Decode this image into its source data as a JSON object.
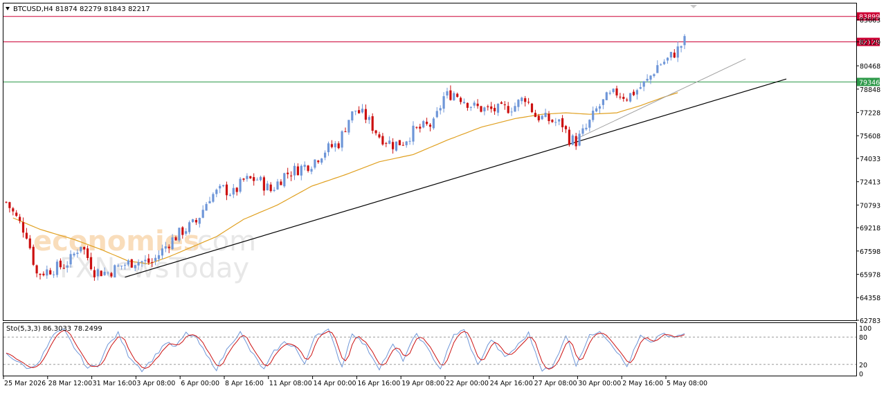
{
  "chart_data": [
    {
      "type": "candlestick",
      "symbol_header": "BTCUSD,H4  81874 82279 81843 82217",
      "y_ticks": [
        83663,
        82129,
        80468,
        78848,
        77228,
        75608,
        74033,
        72413,
        70793,
        69218,
        67598,
        65978,
        64358,
        62783
      ],
      "ylim": [
        62783,
        84800
      ],
      "x_ticks": [
        "25 Mar 2026",
        "28 Mar 12:00",
        "31 Mar 16:00",
        "3 Apr 08:00",
        "6 Apr 00:00",
        "8 Apr 16:00",
        "11 Apr 08:00",
        "14 Apr 00:00",
        "16 Apr 16:00",
        "19 Apr 08:00",
        "22 Apr 00:00",
        "24 Apr 16:00",
        "27 Apr 08:00",
        "30 Apr 00:00",
        "2 May 16:00",
        "5 May 08:00"
      ],
      "bull_color": "#6e96d8",
      "bear_color": "#cc1010",
      "ma_color": "#e0a020",
      "price_anchors": [
        [
          0,
          71000
        ],
        [
          6,
          68800
        ],
        [
          9,
          66000
        ],
        [
          13,
          66300
        ],
        [
          17,
          66600
        ],
        [
          19,
          67000
        ],
        [
          22,
          68100
        ],
        [
          26,
          66200
        ],
        [
          30,
          66100
        ],
        [
          34,
          66600
        ],
        [
          38,
          66900
        ],
        [
          43,
          66800
        ],
        [
          48,
          68200
        ],
        [
          52,
          69000
        ],
        [
          56,
          69600
        ],
        [
          60,
          71400
        ],
        [
          64,
          71900
        ],
        [
          67,
          71600
        ],
        [
          70,
          72500
        ],
        [
          74,
          72600
        ],
        [
          78,
          71800
        ],
        [
          82,
          72900
        ],
        [
          86,
          73300
        ],
        [
          90,
          73700
        ],
        [
          94,
          74600
        ],
        [
          98,
          75100
        ],
        [
          101,
          76800
        ],
        [
          103,
          77400
        ],
        [
          106,
          76900
        ],
        [
          110,
          75600
        ],
        [
          114,
          75000
        ],
        [
          117,
          75200
        ],
        [
          120,
          75900
        ],
        [
          123,
          76200
        ],
        [
          126,
          76400
        ],
        [
          129,
          78300
        ],
        [
          132,
          78600
        ],
        [
          135,
          78100
        ],
        [
          138,
          77600
        ],
        [
          142,
          77400
        ],
        [
          146,
          77400
        ],
        [
          150,
          77700
        ],
        [
          153,
          78300
        ],
        [
          156,
          77000
        ],
        [
          160,
          76700
        ],
        [
          164,
          76400
        ],
        [
          166,
          75400
        ],
        [
          168,
          75200
        ],
        [
          171,
          76100
        ],
        [
          174,
          77400
        ],
        [
          177,
          78200
        ],
        [
          180,
          78600
        ],
        [
          183,
          78300
        ],
        [
          186,
          78800
        ],
        [
          189,
          79400
        ],
        [
          192,
          80500
        ],
        [
          195,
          80900
        ],
        [
          198,
          81600
        ],
        [
          200,
          82200
        ]
      ],
      "ma_anchors": [
        [
          2,
          69900
        ],
        [
          10,
          69100
        ],
        [
          20,
          68400
        ],
        [
          28,
          67700
        ],
        [
          36,
          66900
        ],
        [
          42,
          66700
        ],
        [
          48,
          67200
        ],
        [
          55,
          67900
        ],
        [
          62,
          68600
        ],
        [
          70,
          69800
        ],
        [
          80,
          70800
        ],
        [
          90,
          72100
        ],
        [
          100,
          72900
        ],
        [
          110,
          73800
        ],
        [
          120,
          74300
        ],
        [
          130,
          75300
        ],
        [
          140,
          76200
        ],
        [
          150,
          76800
        ],
        [
          158,
          77100
        ],
        [
          165,
          77200
        ],
        [
          172,
          77100
        ],
        [
          180,
          77200
        ],
        [
          187,
          77700
        ],
        [
          194,
          78300
        ],
        [
          198,
          78600
        ]
      ],
      "hlines": [
        {
          "price": 83899,
          "color": "#cc0033",
          "label": "83899"
        },
        {
          "price": 82129,
          "color": "#cc0033",
          "label": "82129"
        },
        {
          "price": 79346,
          "color": "#2e9a4a",
          "label": "79346"
        }
      ],
      "trendlines": [
        {
          "from": [
            35,
            65780
          ],
          "to": [
            230,
            79550
          ],
          "color": "#000000",
          "width": 1.2
        },
        {
          "from": [
            168,
            75380
          ],
          "to": [
            218,
            80950
          ],
          "color": "#a0a0a0",
          "width": 1
        }
      ]
    },
    {
      "type": "line",
      "indicator_label": "Sto(5,3,3) 86.3033 78.2499",
      "y_ticks": [
        100,
        80,
        20,
        0
      ],
      "ylim": [
        0,
        100
      ],
      "levels": [
        80,
        20
      ],
      "main_color": "#6e96d8",
      "signal_color": "#cc1010",
      "stoch_anchors": [
        [
          0,
          45
        ],
        [
          4,
          22
        ],
        [
          7,
          10
        ],
        [
          10,
          30
        ],
        [
          14,
          85
        ],
        [
          17,
          95
        ],
        [
          20,
          58
        ],
        [
          24,
          12
        ],
        [
          27,
          18
        ],
        [
          30,
          62
        ],
        [
          33,
          88
        ],
        [
          36,
          40
        ],
        [
          40,
          8
        ],
        [
          43,
          30
        ],
        [
          47,
          68
        ],
        [
          50,
          58
        ],
        [
          53,
          88
        ],
        [
          56,
          78
        ],
        [
          59,
          40
        ],
        [
          62,
          10
        ],
        [
          66,
          65
        ],
        [
          69,
          90
        ],
        [
          72,
          50
        ],
        [
          76,
          8
        ],
        [
          79,
          48
        ],
        [
          82,
          68
        ],
        [
          85,
          60
        ],
        [
          88,
          18
        ],
        [
          91,
          85
        ],
        [
          95,
          95
        ],
        [
          99,
          15
        ],
        [
          102,
          90
        ],
        [
          106,
          60
        ],
        [
          110,
          12
        ],
        [
          114,
          62
        ],
        [
          117,
          30
        ],
        [
          121,
          88
        ],
        [
          125,
          45
        ],
        [
          128,
          10
        ],
        [
          132,
          85
        ],
        [
          135,
          95
        ],
        [
          139,
          18
        ],
        [
          143,
          75
        ],
        [
          147,
          35
        ],
        [
          150,
          55
        ],
        [
          154,
          88
        ],
        [
          158,
          8
        ],
        [
          161,
          12
        ],
        [
          165,
          85
        ],
        [
          168,
          20
        ],
        [
          172,
          82
        ],
        [
          175,
          95
        ],
        [
          179,
          60
        ],
        [
          183,
          15
        ],
        [
          187,
          82
        ],
        [
          190,
          65
        ],
        [
          193,
          88
        ],
        [
          196,
          78
        ],
        [
          200,
          86
        ]
      ]
    }
  ],
  "watermark": {
    "line1_colored": "economies",
    "line1_suffix": ".com",
    "line2": "FXNewsToday"
  }
}
